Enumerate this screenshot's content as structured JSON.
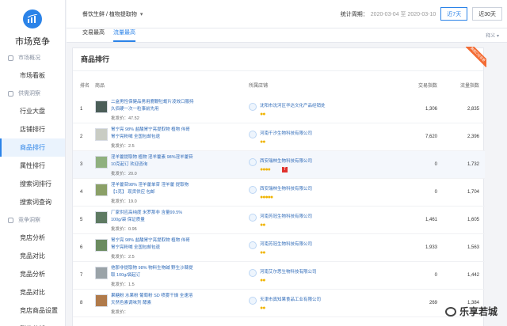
{
  "sidebar": {
    "title": "市场竞争",
    "groups": [
      {
        "label": "市场概况",
        "items": [
          "市场看板"
        ]
      },
      {
        "label": "供需洞察",
        "items": [
          "行业大盘",
          "店铺排行",
          "商品排行",
          "属性排行",
          "搜索词排行",
          "搜索词查询"
        ]
      },
      {
        "label": "竞争洞察",
        "items": [
          "竞店分析",
          "竞品对比",
          "竞品分析",
          "竞品对比",
          "竞店商品设置",
          "群体分析"
        ]
      }
    ],
    "active_item": "商品排行"
  },
  "topbar": {
    "category": "餐饮生鲜 / 植物提取物",
    "period_label": "统计周期：",
    "period_range": "2020-03-04 至 2020-03-10",
    "btn_7": "近7天",
    "btn_30": "近30天"
  },
  "subtabs": {
    "tab_trade": "交易最高",
    "tab_flow": "流量最高",
    "explain": "释义"
  },
  "card": {
    "title": "商品排行",
    "ribbon": "数据口径变更"
  },
  "table": {
    "headers": {
      "rank": "排名",
      "product": "商品",
      "shop": "所属店铺",
      "trade": "交易指数",
      "flow": "流量指数"
    },
    "rows": [
      {
        "rank": "1",
        "name": "二盒男性保健品男用鹿鞭牡蛎片凌效口服持久佰硬一次一粒事前先用",
        "price": "批发价：47.52",
        "shop": "沈阳市沈河区华达文化产品经销处",
        "stars": "●●",
        "tmall": false,
        "trade": "1,306",
        "flow": "2,835",
        "thumb": "#4b5e58"
      },
      {
        "rank": "2",
        "name": "胃宁亮 98% 盐酸胃宁亮提取物 植物 伟哥 胃宁亮粉喊 全国包邮包退",
        "price": "批发价：2.5",
        "shop": "河南千汐生物科技有限公司",
        "stars": "●●",
        "tmall": false,
        "trade": "7,620",
        "flow": "2,396",
        "thumb": "#c9ccc4"
      },
      {
        "rank": "3",
        "name": "淫羊藿提取物 植物 淫羊藿素 98%淫羊藿苷 10克起订 欢迎咨询",
        "price": "批发价：20.0",
        "shop": "西安瑞林生物科技有限公司",
        "stars": "●●●●",
        "tmall": true,
        "trade": "0",
        "flow": "1,732",
        "thumb": "#8fb07f"
      },
      {
        "rank": "4",
        "name": "淫羊藿苷98% 淫羊藿单苷 淫羊藿 提取物 【1克】 现货供应 包邮",
        "price": "批发价：19.0",
        "shop": "西安瑞林生物科技有限公司",
        "stars": "●●●●●",
        "tmall": false,
        "trade": "0",
        "flow": "1,704",
        "thumb": "#8ba067"
      },
      {
        "rank": "5",
        "name": "厂家供应高纯度 米罗那非 含量99.5% 100g/袋 保证质量",
        "price": "批发价：0.95",
        "shop": "河南芳冠生物科技有限公司",
        "stars": "●●",
        "tmall": false,
        "trade": "1,461",
        "flow": "1,605",
        "thumb": "#5e7a62"
      },
      {
        "rank": "6",
        "name": "胃宁亮 98% 盐酸胃宁亮提取物 植物 伟哥 胃宁亮粉喊 全国包邮包退",
        "price": "批发价：2.5",
        "shop": "河南芳冠生物科技有限公司",
        "stars": "●●",
        "tmall": false,
        "trade": "1,933",
        "flow": "1,563",
        "thumb": "#6b8b5f"
      },
      {
        "rank": "7",
        "name": "他那非提取物 98% 物料生物碱 野生沙棘提取 100g/袋起订",
        "price": "批发价：1.5",
        "shop": "河南艾尔思生物科技有限公司",
        "stars": "●●",
        "tmall": false,
        "trade": "0",
        "flow": "1,442",
        "thumb": "#9aa3a8"
      },
      {
        "rank": "8",
        "name": "果糖粉 水果粉 葡萄粉 SD 喷雾干燥 全速溶 天然色素调味剂 酵素",
        "price": "批发价：",
        "shop": "天津市真知果食品工业有限公司",
        "stars": "●●",
        "tmall": false,
        "trade": "269",
        "flow": "1,384",
        "thumb": "#b07a4a"
      }
    ]
  },
  "watermark": "乐享若城"
}
